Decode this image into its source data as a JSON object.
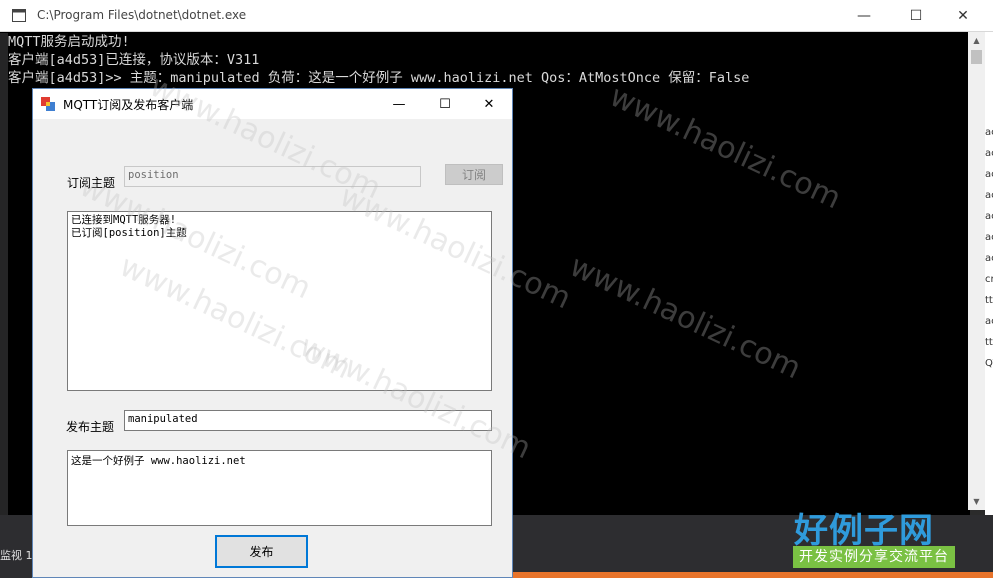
{
  "console": {
    "title": "C:\\Program Files\\dotnet\\dotnet.exe",
    "lines": [
      "MQTT服务启动成功!",
      "客户端[a4d53]已连接，协议版本：V311",
      "客户端[a4d53]>> 主题：manipulated 负荷：这是一个好例子 www.haolizi.net Qos：AtMostOnce 保留：False"
    ],
    "controls": {
      "minimize": "—",
      "maximize": "☐",
      "close": "✕"
    }
  },
  "side_panel": {
    "rows": [
      "ac",
      "ac",
      "ac",
      "ac",
      "ac",
      "ac",
      "ac",
      "cr",
      "tt",
      "ac",
      "tt",
      "QT"
    ]
  },
  "taskbar": {
    "monitor_label": "监视 1"
  },
  "dialog": {
    "title": "MQTT订阅及发布客户端",
    "controls": {
      "minimize": "—",
      "maximize": "☐",
      "close": "✕"
    },
    "subscribe": {
      "label": "订阅主题",
      "topic_value": "position",
      "button_label": "订阅"
    },
    "log_lines": [
      "已连接到MQTT服务器!",
      "已订阅[position]主题"
    ],
    "publish": {
      "label": "发布主题",
      "topic_value": "manipulated",
      "payload_value": "这是一个好例子 www.haolizi.net",
      "button_label": "发布"
    }
  },
  "watermark": {
    "text": "www.haolizi.com"
  },
  "logo": {
    "main": "好例子网",
    "sub": "开发实例分享交流平台"
  },
  "colors": {
    "dialog_border": "#5f86b8",
    "focus_blue": "#0078d7",
    "logo_blue": "#2f9bdc",
    "logo_green": "#7ac143",
    "orange": "#e8742b"
  }
}
